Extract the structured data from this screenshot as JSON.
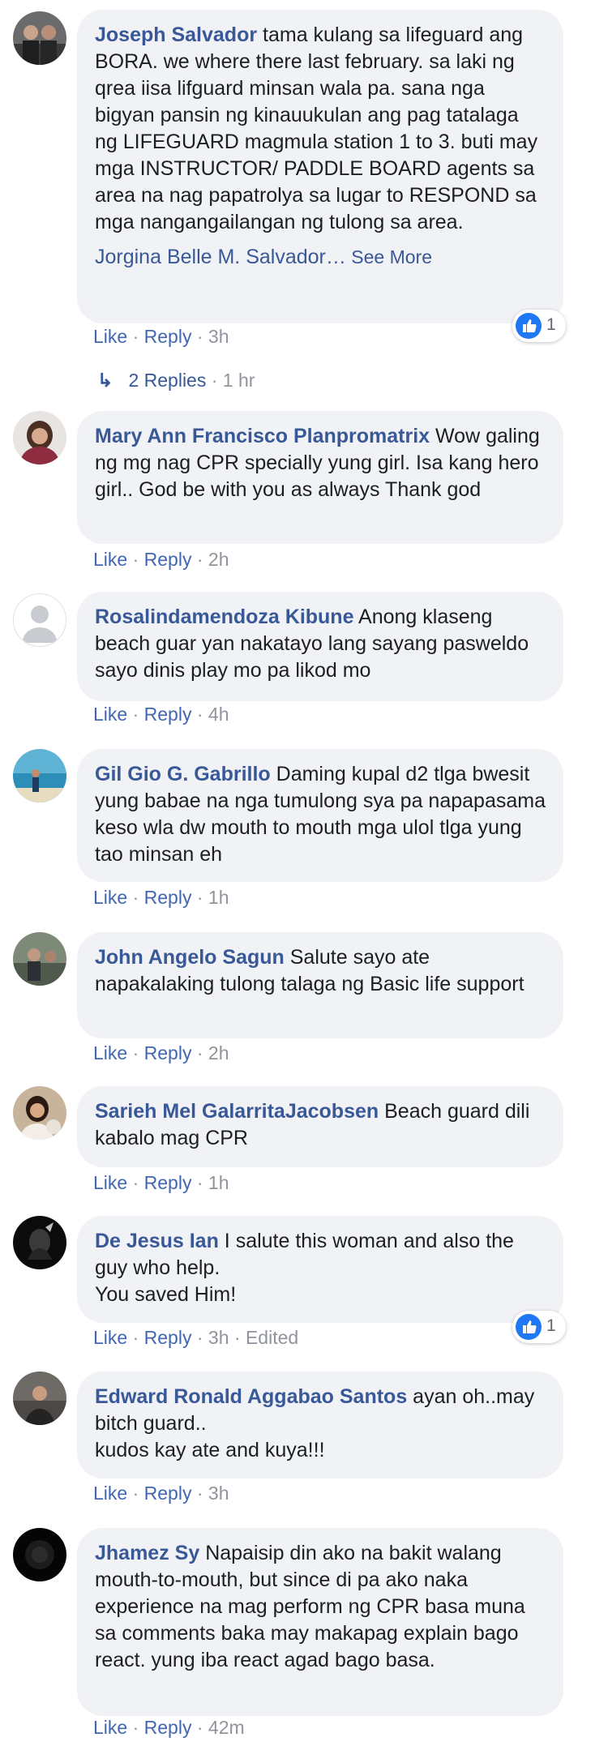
{
  "colors": {
    "link": "#385898",
    "meta": "#90949c",
    "bubble": "#f1f2f5",
    "like_blue": "#2078f4"
  },
  "actions": {
    "like": "Like",
    "reply": "Reply",
    "sep": " · "
  },
  "comments": [
    {
      "author": "Joseph Salvador",
      "text": " tama kulang sa lifeguard ang BORA. we where there last february. sa laki ng qrea iisa lifguard minsan wala pa. sana nga bigyan pansin ng kinauukulan ang pag tatalaga ng LIFEGUARD magmula station 1 to 3. buti may mga INSTRUCTOR/ PADDLE BOARD agents sa area na nag papatrolya sa lugar to RESPOND sa mga nangangailangan ng tulong sa area.",
      "mention": "Jorgina Belle M. Salvador…",
      "see_more": " See More",
      "time": "3h",
      "reactions": "1",
      "avatar_icon": "profile-photo"
    },
    {
      "author": "Mary Ann Francisco Planpromatrix",
      "text": " Wow galing ng mg nag CPR specially yung girl. Isa kang hero girl.. God be with you as always Thank god",
      "time": "2h",
      "avatar_icon": "profile-photo"
    },
    {
      "author": "Rosalindamendoza Kibune",
      "text": " Anong klaseng beach guar yan nakatayo lang sayang pasweldo sayo dinis play mo pa likod mo",
      "time": "4h",
      "avatar_icon": "default-profile-icon"
    },
    {
      "author": "Gil Gio G. Gabrillo",
      "text": " Daming kupal d2 tlga bwesit yung babae na nga tumulong sya pa napapasama keso wla dw mouth to mouth mga ulol tlga yung tao minsan eh",
      "time": "1h",
      "avatar_icon": "profile-photo"
    },
    {
      "author": "John Angelo Sagun",
      "text": " Salute sayo ate napakalaking tulong talaga ng Basic life support",
      "time": "2h",
      "avatar_icon": "profile-photo"
    },
    {
      "author": "Sarieh Mel GalarritaJacobsen",
      "text": " Beach guard dili kabalo mag CPR",
      "time": "1h",
      "avatar_icon": "profile-photo"
    },
    {
      "author": "De Jesus Ian",
      "text": " I salute this woman and also the guy who help.\nYou saved Him!",
      "time": "3h",
      "edited": "Edited",
      "reactions": "1",
      "avatar_icon": "profile-photo"
    },
    {
      "author": "Edward Ronald Aggabao Santos",
      "text": " ayan oh..may bitch guard..\nkudos kay ate and kuya!!!",
      "time": "3h",
      "avatar_icon": "profile-photo"
    },
    {
      "author": "Jhamez Sy",
      "text": " Napaisip din ako na bakit walang mouth-to-mouth, but since di pa ako naka experience na mag perform ng CPR basa muna sa comments baka may makapag explain bago react. yung iba react agad bago basa.",
      "time": "42m",
      "avatar_icon": "profile-photo"
    }
  ],
  "replies": {
    "arrow": "↳",
    "label": "2 Replies",
    "time": "1 hr"
  }
}
